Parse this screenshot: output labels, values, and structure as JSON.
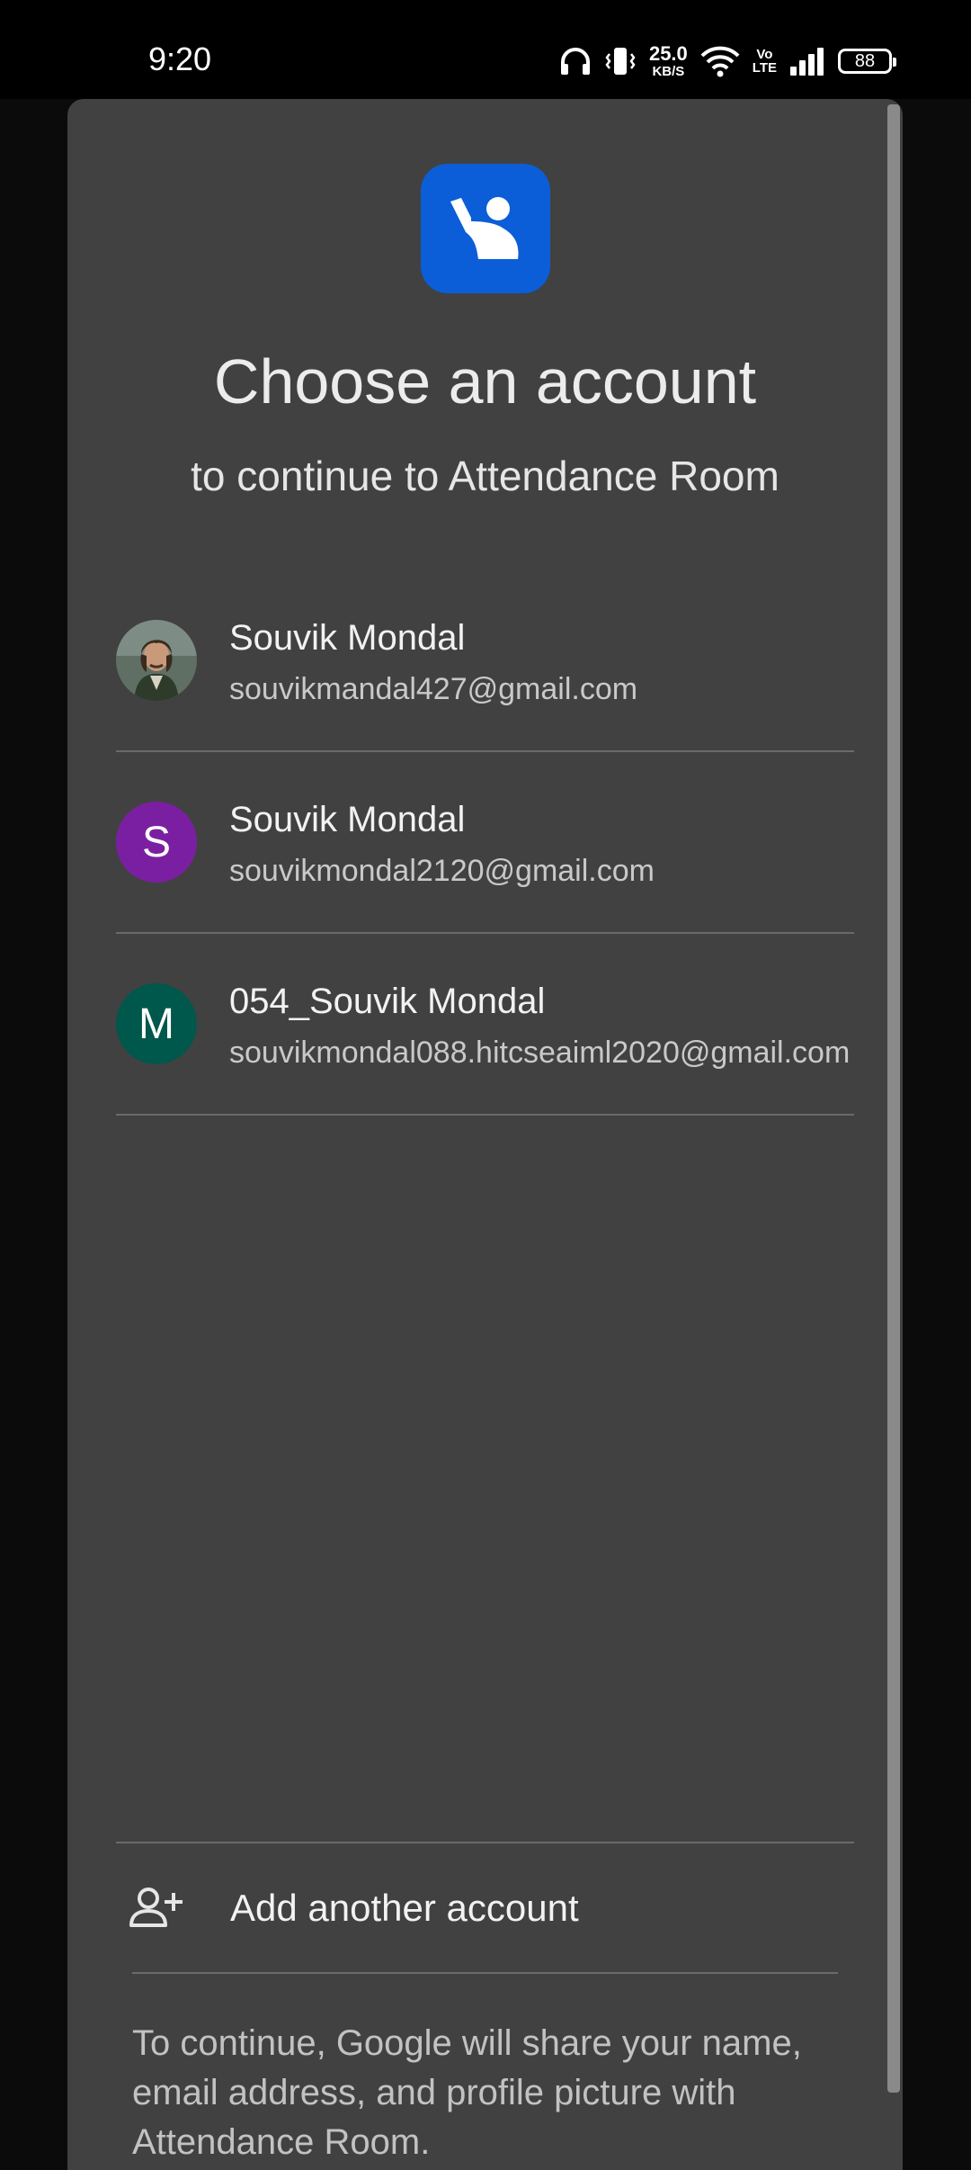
{
  "status_bar": {
    "time": "9:20",
    "net_speed_value": "25.0",
    "net_speed_unit": "KB/S",
    "volte_top": "Vo",
    "volte_bottom": "LTE",
    "battery": "88",
    "icons": [
      "headphones-icon",
      "vibrate-icon",
      "wifi-icon",
      "signal-icon",
      "battery-icon"
    ]
  },
  "dialog": {
    "app_icon": "attendance-room-logo-icon",
    "accent_color": "#0b5ed7",
    "title": "Choose an account",
    "subtitle": "to continue to Attendance Room",
    "accounts": [
      {
        "name": "Souvik Mondal",
        "email": "souvikmandal427@gmail.com",
        "avatar_type": "photo",
        "avatar_letter": ""
      },
      {
        "name": "Souvik Mondal",
        "email": "souvikmondal2120@gmail.com",
        "avatar_type": "letter",
        "avatar_letter": "S",
        "avatar_color": "#7b1fa2"
      },
      {
        "name": "054_Souvik Mondal",
        "email": "souvikmondal088.hitcseaiml2020@gmail.com",
        "avatar_type": "letter",
        "avatar_letter": "M",
        "avatar_color": "#00574b"
      }
    ],
    "add_account_label": "Add another account",
    "add_account_icon": "person-add-icon",
    "footer": "To continue, Google will share your name, email address, and profile picture with Attendance Room."
  }
}
